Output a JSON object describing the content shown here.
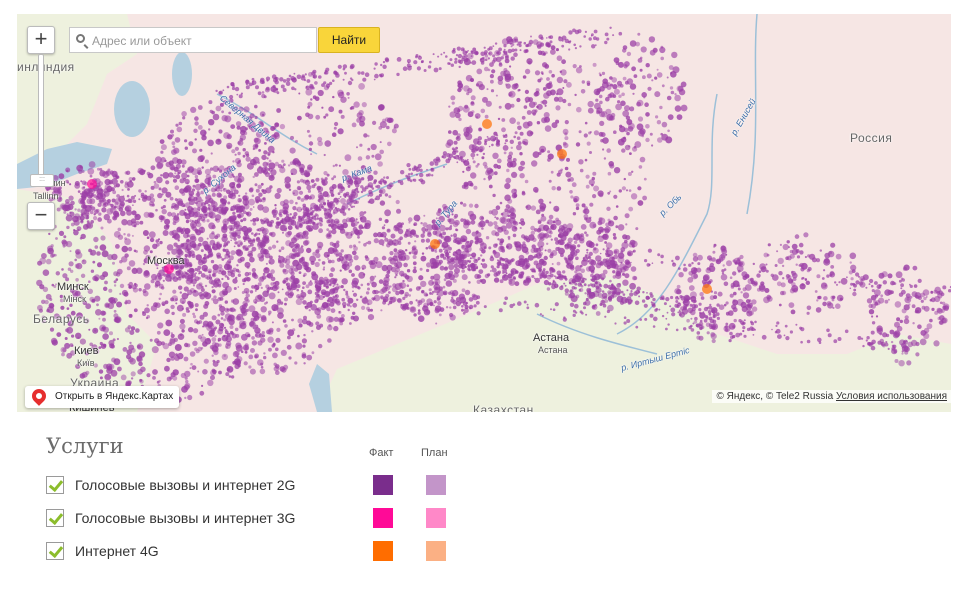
{
  "map": {
    "search": {
      "placeholder": "Адрес или объект",
      "button": "Найти"
    },
    "zoom": {
      "in_label": "+",
      "out_label": "−",
      "handle_label": ":::"
    },
    "open_link": "Открыть в Яндекс.Картах",
    "copyright": "© Яндекс, © Tele2 Russia",
    "terms": "Условия использования",
    "labels": {
      "finland": "инляндия",
      "tallinn": "Таллин",
      "tallinn_latin": "Tallinn",
      "moscow": "Москва",
      "minsk": "Минск",
      "minsk_small": "Мінск",
      "belarus": "Беларусь",
      "kiev": "Киев",
      "kiev_small": "Київ",
      "ukraine": "Украина",
      "kishinev": "Кишинев",
      "astana": "Астана",
      "astana_small": "Астана",
      "kazakhstan": "Казахстан",
      "russia": "Россия",
      "river_kama": "р. Кама",
      "river_tura": "р. Тура",
      "river_ob": "р. Обь",
      "river_yenisei": "р. Енисей",
      "river_irtysh": "р. Иртыш Ертіс",
      "river_sukhona": "р. Сухона",
      "river_sev_dvina": "Северная Двина"
    }
  },
  "legend": {
    "title": "Услуги",
    "fact_header": "Факт",
    "plan_header": "План",
    "services": [
      {
        "label": "Голосовые вызовы и интернет 2G",
        "checked": true,
        "fact_color": "#7a2d8c",
        "plan_color": "#c395c9"
      },
      {
        "label": "Голосовые вызовы и интернет 3G",
        "checked": true,
        "fact_color": "#ff0a97",
        "plan_color": "#ff88c8"
      },
      {
        "label": "Интернет 4G",
        "checked": true,
        "fact_color": "#ff6d00",
        "plan_color": "#fbb084"
      }
    ]
  },
  "colors": {
    "land_russia": "#f6e6e4",
    "land_other": "#eef1de",
    "water": "#b5d0e0",
    "coverage": "#9b3fa6"
  }
}
